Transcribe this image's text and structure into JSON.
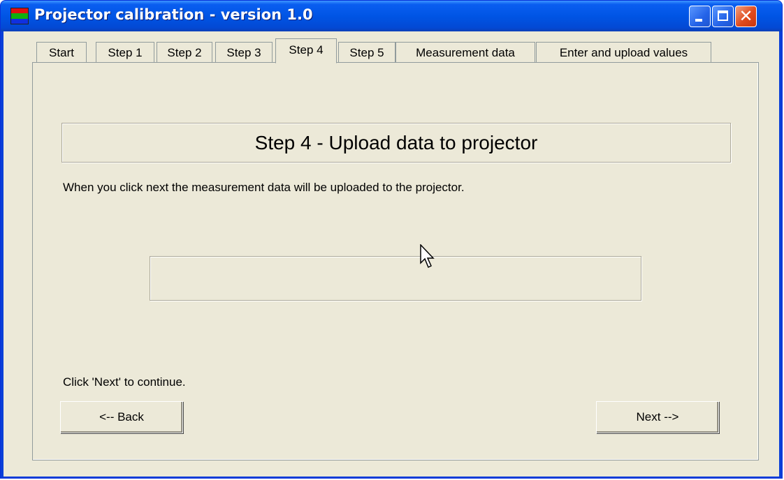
{
  "window": {
    "title": "Projector calibration - version 1.0",
    "controls": {
      "minimize": "minimize",
      "maximize": "maximize",
      "close": "✕"
    }
  },
  "tabs": [
    {
      "label": "Start"
    },
    {
      "label": "Step 1"
    },
    {
      "label": "Step 2"
    },
    {
      "label": "Step 3"
    },
    {
      "label": "Step 4",
      "active": true
    },
    {
      "label": "Step 5"
    },
    {
      "label": "Measurement data"
    },
    {
      "label": "Enter and upload values"
    }
  ],
  "panel": {
    "heading": "Step 4 - Upload data to projector",
    "description": "When you click next the measurement data will be uploaded to the projector.",
    "progress_percent": 0,
    "hint": "Click 'Next' to continue."
  },
  "buttons": {
    "back": "<-- Back",
    "next": "Next -->"
  },
  "icons": {
    "app": "rgb-stripes-icon",
    "cursor": "mouse-pointer-icon"
  }
}
